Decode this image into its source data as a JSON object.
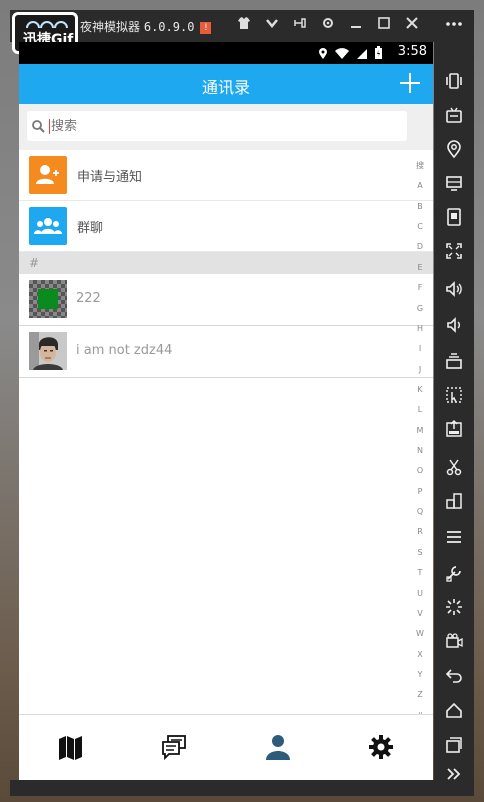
{
  "emulator": {
    "title": "夜神模拟器",
    "version": "6.0.9.0",
    "alert": "!",
    "logo_text": "迅捷Gif"
  },
  "status_bar": {
    "time": "3:58"
  },
  "app_bar": {
    "title": "通讯录",
    "add_icon": "plus-icon"
  },
  "search": {
    "placeholder": "搜索"
  },
  "menu": [
    {
      "label": "申请与通知",
      "icon": "add-user-icon",
      "color": "#f58a1f"
    },
    {
      "label": "群聊",
      "icon": "group-icon",
      "color": "#1ea8ef"
    }
  ],
  "section_header": "#",
  "contacts": [
    {
      "name": "222",
      "avatar": "checker-avatar"
    },
    {
      "name": "i am not zdz44",
      "avatar": "photo-avatar"
    }
  ],
  "index_letters": [
    "搜",
    "A",
    "B",
    "C",
    "D",
    "E",
    "F",
    "G",
    "H",
    "I",
    "J",
    "K",
    "L",
    "M",
    "N",
    "O",
    "P",
    "Q",
    "R",
    "S",
    "T",
    "U",
    "V",
    "W",
    "X",
    "Y",
    "Z",
    "#"
  ],
  "bottom_nav": [
    {
      "name": "map-icon"
    },
    {
      "name": "chat-icon"
    },
    {
      "name": "contacts-icon",
      "active": true
    },
    {
      "name": "settings-icon"
    }
  ],
  "colors": {
    "primary": "#1ea8ef",
    "active_nav": "#2d5b7a"
  }
}
